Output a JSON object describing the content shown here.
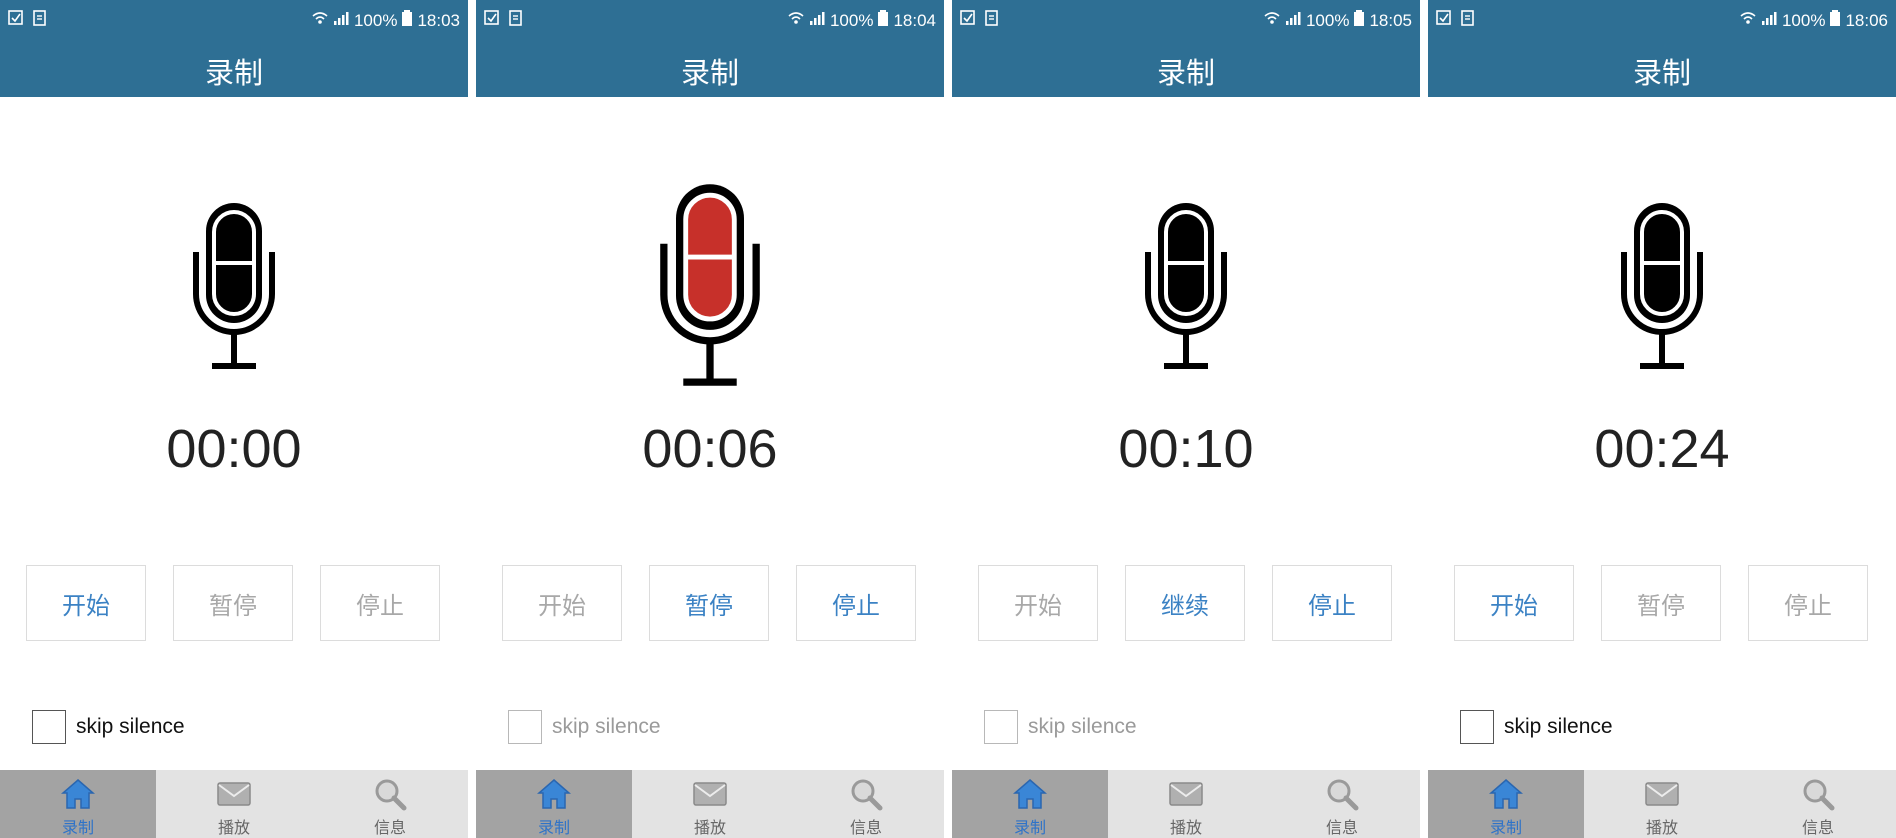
{
  "colors": {
    "bar": "#2e6f94",
    "accent": "#3b82c4",
    "disabled": "#a8a8a8",
    "recording": "#c7302a",
    "tab_selected_bg": "#a3a3a3",
    "tab_bg": "#e3e3e3"
  },
  "screens": [
    {
      "status": {
        "battery": "100%",
        "time": "18:03"
      },
      "title": "录制",
      "timer": "00:00",
      "recording": false,
      "buttons": [
        {
          "label": "开始",
          "state": "active"
        },
        {
          "label": "暂停",
          "state": "inactive"
        },
        {
          "label": "停止",
          "state": "inactive"
        }
      ],
      "checkbox": {
        "label": "skip silence",
        "enabled": true,
        "checked": false
      },
      "tabs": [
        {
          "label": "录制",
          "icon": "home-icon",
          "selected": true
        },
        {
          "label": "播放",
          "icon": "mail-icon",
          "selected": false
        },
        {
          "label": "信息",
          "icon": "search-icon",
          "selected": false
        }
      ]
    },
    {
      "status": {
        "battery": "100%",
        "time": "18:04"
      },
      "title": "录制",
      "timer": "00:06",
      "recording": true,
      "buttons": [
        {
          "label": "开始",
          "state": "inactive"
        },
        {
          "label": "暂停",
          "state": "active"
        },
        {
          "label": "停止",
          "state": "active"
        }
      ],
      "checkbox": {
        "label": "skip silence",
        "enabled": false,
        "checked": false
      },
      "tabs": [
        {
          "label": "录制",
          "icon": "home-icon",
          "selected": true
        },
        {
          "label": "播放",
          "icon": "mail-icon",
          "selected": false
        },
        {
          "label": "信息",
          "icon": "search-icon",
          "selected": false
        }
      ]
    },
    {
      "status": {
        "battery": "100%",
        "time": "18:05"
      },
      "title": "录制",
      "timer": "00:10",
      "recording": false,
      "buttons": [
        {
          "label": "开始",
          "state": "inactive"
        },
        {
          "label": "继续",
          "state": "active"
        },
        {
          "label": "停止",
          "state": "active"
        }
      ],
      "checkbox": {
        "label": "skip silence",
        "enabled": false,
        "checked": false
      },
      "tabs": [
        {
          "label": "录制",
          "icon": "home-icon",
          "selected": true
        },
        {
          "label": "播放",
          "icon": "mail-icon",
          "selected": false
        },
        {
          "label": "信息",
          "icon": "search-icon",
          "selected": false
        }
      ]
    },
    {
      "status": {
        "battery": "100%",
        "time": "18:06"
      },
      "title": "录制",
      "timer": "00:24",
      "recording": false,
      "buttons": [
        {
          "label": "开始",
          "state": "active"
        },
        {
          "label": "暂停",
          "state": "inactive"
        },
        {
          "label": "停止",
          "state": "inactive"
        }
      ],
      "checkbox": {
        "label": "skip silence",
        "enabled": true,
        "checked": false
      },
      "tabs": [
        {
          "label": "录制",
          "icon": "home-icon",
          "selected": true
        },
        {
          "label": "播放",
          "icon": "mail-icon",
          "selected": false
        },
        {
          "label": "信息",
          "icon": "search-icon",
          "selected": false
        }
      ]
    }
  ]
}
